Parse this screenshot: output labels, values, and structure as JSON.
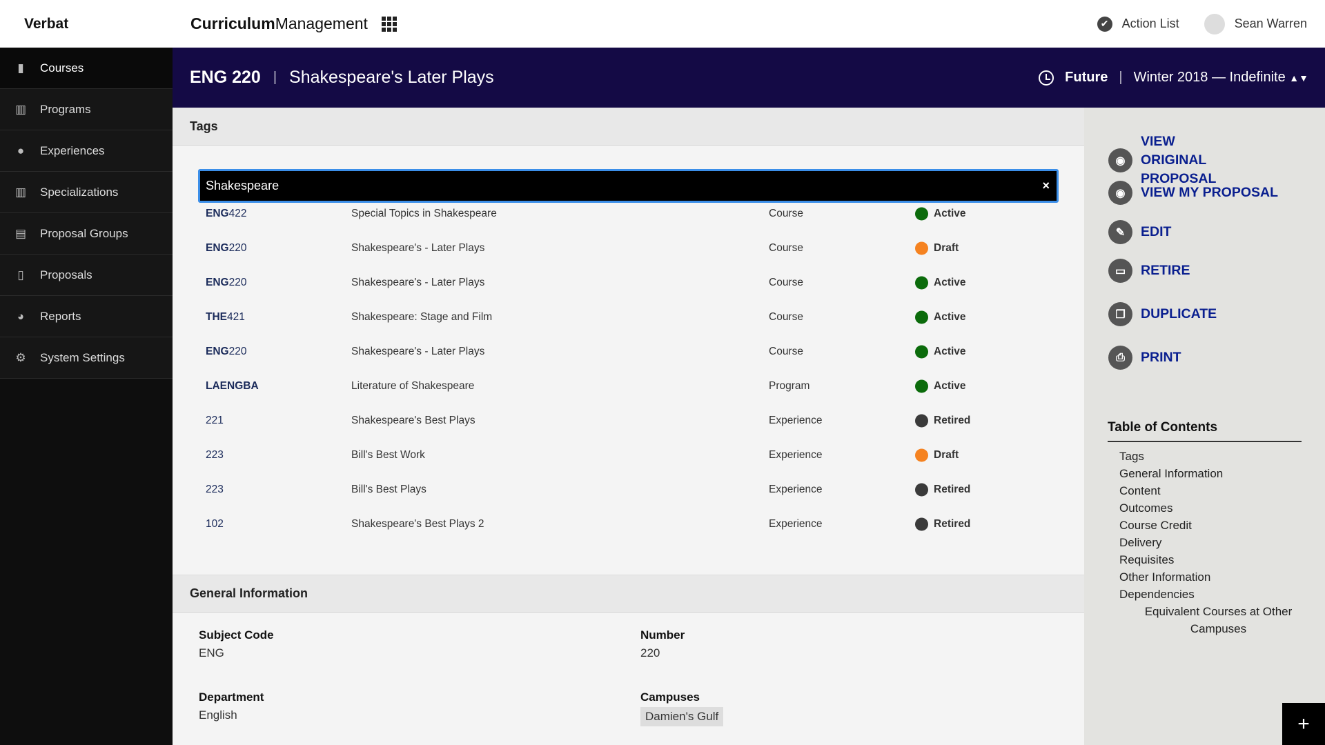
{
  "topbar": {
    "brand": "Verbat",
    "app_bold": "Curriculum",
    "app_rest": "Management",
    "action_list": "Action List",
    "user": "Sean Warren"
  },
  "sidebar": {
    "items": [
      {
        "label": "Courses",
        "icon": "book-icon",
        "active": true
      },
      {
        "label": "Programs",
        "icon": "library-icon"
      },
      {
        "label": "Experiences",
        "icon": "lightbulb-icon"
      },
      {
        "label": "Specializations",
        "icon": "books-icon"
      },
      {
        "label": "Proposal Groups",
        "icon": "documents-icon"
      },
      {
        "label": "Proposals",
        "icon": "document-icon"
      },
      {
        "label": "Reports",
        "icon": "pie-chart-icon"
      },
      {
        "label": "System Settings",
        "icon": "gear-icon"
      }
    ]
  },
  "header": {
    "code": "ENG 220",
    "separator": "|",
    "title": "Shakespeare's Later Plays",
    "status": "Future",
    "term": "Winter 2018 — Indefinite"
  },
  "tags": {
    "heading": "Tags",
    "search_value": "Shakespeare",
    "clear": "×",
    "results": [
      {
        "prefix": "ENG",
        "num": "422",
        "title": "Special Topics in Shakespeare",
        "type": "Course",
        "status": "Active"
      },
      {
        "prefix": "ENG",
        "num": "220",
        "title": "Shakespeare's - Later Plays",
        "type": "Course",
        "status": "Draft"
      },
      {
        "prefix": "ENG",
        "num": "220",
        "title": "Shakespeare's - Later Plays",
        "type": "Course",
        "status": "Active"
      },
      {
        "prefix": "THE",
        "num": "421",
        "title": "Shakespeare: Stage and Film",
        "type": "Course",
        "status": "Active"
      },
      {
        "prefix": "ENG",
        "num": "220",
        "title": "Shakespeare's - Later Plays",
        "type": "Course",
        "status": "Active"
      },
      {
        "prefix": "LAENGBA",
        "num": "",
        "title": "Literature of Shakespeare",
        "type": "Program",
        "status": "Active"
      },
      {
        "prefix": "",
        "num": "221",
        "title": "Shakespeare's Best Plays",
        "type": "Experience",
        "status": "Retired"
      },
      {
        "prefix": "",
        "num": "223",
        "title": "Bill's Best Work",
        "type": "Experience",
        "status": "Draft"
      },
      {
        "prefix": "",
        "num": "223",
        "title": "Bill's Best Plays",
        "type": "Experience",
        "status": "Retired"
      },
      {
        "prefix": "",
        "num": "102",
        "title": "Shakespeare's Best Plays 2",
        "type": "Experience",
        "status": "Retired"
      }
    ]
  },
  "status_colors": {
    "Active": "#0b6b0b",
    "Draft": "#f58220",
    "Retired": "#3a3a3a"
  },
  "general": {
    "heading": "General Information",
    "subject_label": "Subject Code",
    "subject": "ENG",
    "number_label": "Number",
    "number": "220",
    "dept_label": "Department",
    "dept": "English",
    "campuses_label": "Campuses",
    "campus": "Damien's Gulf"
  },
  "actions": [
    {
      "label": "VIEW ORIGINAL PROPOSAL",
      "icon": "eye-icon"
    },
    {
      "label": "VIEW MY PROPOSAL",
      "icon": "eye-icon"
    },
    {
      "label": "EDIT",
      "icon": "pencil-icon"
    },
    {
      "label": "RETIRE",
      "icon": "archive-box-icon"
    },
    {
      "label": "DUPLICATE",
      "icon": "copy-icon"
    },
    {
      "label": "PRINT",
      "icon": "printer-icon"
    }
  ],
  "toc": {
    "title": "Table of Contents",
    "items": [
      "Tags",
      "General Information",
      "Content",
      "Outcomes",
      "Course Credit",
      "Delivery",
      "Requisites",
      "Other Information",
      "Dependencies"
    ],
    "sub": "Equivalent Courses at Other Campuses"
  },
  "fab": "+"
}
